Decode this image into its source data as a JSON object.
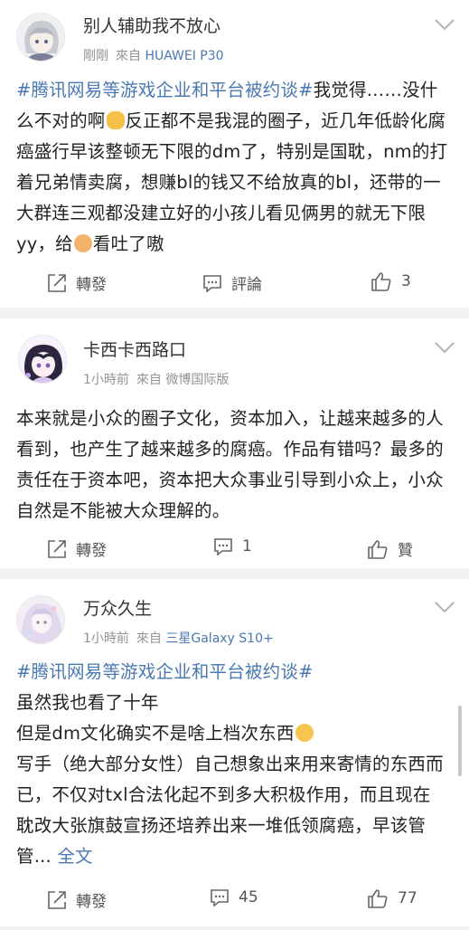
{
  "posts": [
    {
      "username": "别人辅助我不放心",
      "time": "剛剛",
      "from_label": "來自",
      "source": "HUAWEI P30",
      "topic": "#腾讯网易等游戏企业和平台被约谈#",
      "text1": "我觉得……没什么不对的啊",
      "emoji1": "cat-face-emoji",
      "text2": "反正都不是我混的圈子，近几年低龄化腐癌盛行早该整顿无下限的dm了，特别是国耽，nm的打着兄弟情卖腐，想赚bl的钱又不给放真的bl，还带的一大群连三观都没建立好的小孩儿看见俩男的就无下限yy，给",
      "emoji2": "old-man-emoji",
      "text3": "看吐了嗷",
      "repost": "轉發",
      "comment": "評論",
      "like": "3"
    },
    {
      "username": "卡西卡西路口",
      "time": "1小時前",
      "from_label": "來自",
      "source": "微博国际版",
      "text": "本来就是小众的圈子文化，资本加入，让越来越多的人看到，也产生了越来越多的腐癌。作品有错吗？最多的责任在于资本吧，资本把大众事业引导到小众上，小众自然是不能被大众理解的。",
      "repost": "轉發",
      "comment": "1",
      "like": "贊"
    },
    {
      "username": "万众久生",
      "time": "1小時前",
      "from_label": "來自",
      "source": "三星Galaxy S10+",
      "topic": "#腾讯网易等游戏企业和平台被约谈#",
      "line1": "虽然我也看了十年",
      "line2": "但是dm文化确实不是啥上档次东西",
      "emoji": "sleepy-face-emoji",
      "line3": "写手（绝大部分女性）自己想象出来用来寄情的东西而已，不仅对txl合法化起不到多大积极作用，而且现在耽改大张旗鼓宣扬还培养出来一堆低领腐癌，早该管管",
      "ellipsis": "... ",
      "more": "全文",
      "repost": "轉發",
      "comment": "45",
      "like": "77"
    }
  ]
}
